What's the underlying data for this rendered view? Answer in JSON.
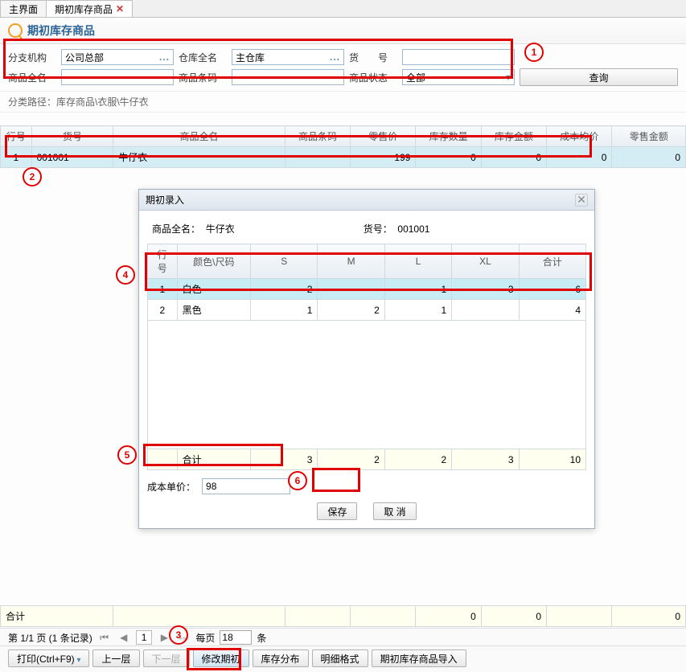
{
  "tabs": [
    {
      "label": "主界面",
      "closable": false,
      "active": false
    },
    {
      "label": "期初库存商品",
      "closable": true,
      "active": true
    }
  ],
  "page_title": "期初库存商品",
  "filters": {
    "branch_label": "分支机构",
    "branch_value": "公司总部",
    "warehouse_label": "仓库全名",
    "warehouse_value": "主仓库",
    "sku_label": "货　　号",
    "sku_value": "",
    "product_label": "商品全名",
    "product_value": "",
    "barcode_label": "商品条码",
    "barcode_value": "",
    "status_label": "商品状态",
    "status_value": "全部",
    "search_btn": "查询"
  },
  "breadcrumb": "分类路径：库存商品\\衣服\\牛仔衣",
  "main_table": {
    "headers": [
      "行号",
      "货号",
      "商品全名",
      "商品条码",
      "零售价",
      "库存数量",
      "库存金额",
      "成本均价",
      "零售金额"
    ],
    "rows": [
      {
        "no": "1",
        "sku": "001001",
        "name": "牛仔衣",
        "barcode": "",
        "price": "199",
        "qty": "0",
        "amount": "0",
        "cost_avg": "0",
        "retail_amt": "0"
      }
    ],
    "total_label": "合计",
    "totals": {
      "qty": "0",
      "amount": "0",
      "retail_amt": "0"
    }
  },
  "dialog": {
    "title": "期初录入",
    "product_label": "商品全名：",
    "product_value": "牛仔衣",
    "sku_label": "货号：",
    "sku_value": "001001",
    "headers": [
      "行号",
      "颜色\\尺码",
      "S",
      "M",
      "L",
      "XL",
      "合计"
    ],
    "rows": [
      {
        "no": "1",
        "color": "白色",
        "s": "2",
        "m": "",
        "l": "1",
        "xl": "3",
        "sum": "6",
        "selected": true
      },
      {
        "no": "2",
        "color": "黑色",
        "s": "1",
        "m": "2",
        "l": "1",
        "xl": "",
        "sum": "4",
        "selected": false
      }
    ],
    "total_row": {
      "label": "合计",
      "s": "3",
      "m": "2",
      "l": "2",
      "xl": "3",
      "sum": "10"
    },
    "cost_label": "成本单价：",
    "cost_value": "98",
    "save_btn": "保存",
    "cancel_btn": "取 消"
  },
  "pager": {
    "summary": "第 1/1 页 (1 条记录)",
    "current_page": "1",
    "per_page_label_before": "每页",
    "per_page_value": "18",
    "per_page_label_after": "条"
  },
  "toolbar": {
    "print": "打印(Ctrl+F9)",
    "up": "上一层",
    "down": "下一层",
    "modify": "修改期初",
    "stock_dist": "库存分布",
    "detail_fmt": "明细格式",
    "import": "期初库存商品导入"
  },
  "callouts": {
    "c1": "1",
    "c2": "2",
    "c3": "3",
    "c4": "4",
    "c5": "5",
    "c6": "6"
  }
}
